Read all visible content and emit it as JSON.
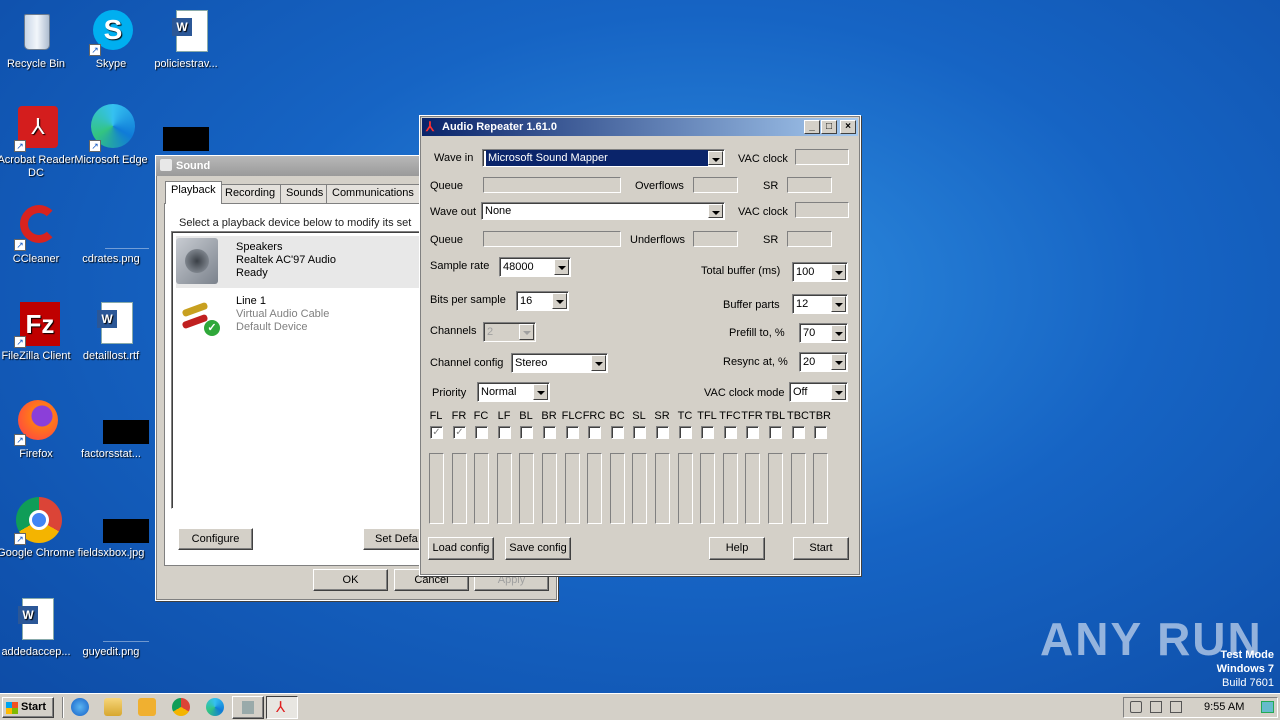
{
  "desktop": {
    "icons": [
      {
        "label": "Recycle Bin",
        "icon": "recycle-bin-icon"
      },
      {
        "label": "Skype",
        "icon": "skype-icon"
      },
      {
        "label": "policiestrav...",
        "icon": "word-doc-icon"
      },
      {
        "label": "Acrobat Reader DC",
        "icon": "acrobat-icon"
      },
      {
        "label": "Microsoft Edge",
        "icon": "edge-icon"
      },
      {
        "label": "CCleaner",
        "icon": "ccleaner-icon"
      },
      {
        "label": "cdrates.png",
        "icon": "image-file-icon"
      },
      {
        "label": "FileZilla Client",
        "icon": "filezilla-icon"
      },
      {
        "label": "detaillost.rtf",
        "icon": "word-doc-icon"
      },
      {
        "label": "Firefox",
        "icon": "firefox-icon"
      },
      {
        "label": "factorsstat...",
        "icon": "image-file-icon"
      },
      {
        "label": "Google Chrome",
        "icon": "chrome-icon"
      },
      {
        "label": "fieldsxbox.jpg",
        "icon": "image-file-icon"
      },
      {
        "label": "addedaccep...",
        "icon": "word-doc-icon"
      },
      {
        "label": "guyedit.png",
        "icon": "image-file-icon"
      }
    ]
  },
  "sound_dialog": {
    "title": "Sound",
    "tabs": [
      "Playback",
      "Recording",
      "Sounds",
      "Communications"
    ],
    "instruction": "Select a playback device below to modify its set",
    "devices": [
      {
        "name": "Speakers",
        "driver": "Realtek AC'97 Audio",
        "status": "Ready"
      },
      {
        "name": "Line 1",
        "driver": "Virtual Audio Cable",
        "status": "Default Device"
      }
    ],
    "configure_label": "Configure",
    "set_default_label": "Set Defa",
    "ok_label": "OK",
    "cancel_label": "Cancel",
    "apply_label": "Apply"
  },
  "audio_repeater": {
    "title": "Audio Repeater 1.61.0",
    "wave_in_label": "Wave in",
    "wave_in_value": "Microsoft Sound Mapper",
    "vac_clock_label": "VAC clock",
    "queue_label": "Queue",
    "overflows_label": "Overflows",
    "sr_label": "SR",
    "wave_out_label": "Wave out",
    "wave_out_value": "None",
    "underflows_label": "Underflows",
    "sample_rate_label": "Sample rate",
    "sample_rate_value": "48000",
    "total_buffer_label": "Total buffer (ms)",
    "total_buffer_value": "100",
    "bits_label": "Bits per sample",
    "bits_value": "16",
    "buffer_parts_label": "Buffer parts",
    "buffer_parts_value": "12",
    "channels_label": "Channels",
    "channels_value": "2",
    "prefill_label": "Prefill to, %",
    "prefill_value": "70",
    "channel_config_label": "Channel config",
    "channel_config_value": "Stereo",
    "resync_label": "Resync at, %",
    "resync_value": "20",
    "priority_label": "Priority",
    "priority_value": "Normal",
    "vac_clock_mode_label": "VAC clock mode",
    "vac_clock_mode_value": "Off",
    "channels_list": [
      "FL",
      "FR",
      "FC",
      "LF",
      "BL",
      "BR",
      "FLC",
      "FRC",
      "BC",
      "SL",
      "SR",
      "TC",
      "TFL",
      "TFC",
      "TFR",
      "TBL",
      "TBC",
      "TBR"
    ],
    "checked_channels": [
      "FL",
      "FR"
    ],
    "load_config_label": "Load config",
    "save_config_label": "Save config",
    "help_label": "Help",
    "start_label": "Start"
  },
  "taskbar": {
    "start_label": "Start",
    "clock": "9:55 AM"
  },
  "watermark": "ANY RUN",
  "test_mode": {
    "line1": "Test Mode",
    "line2": "Windows 7",
    "line3": "Build 7601"
  }
}
